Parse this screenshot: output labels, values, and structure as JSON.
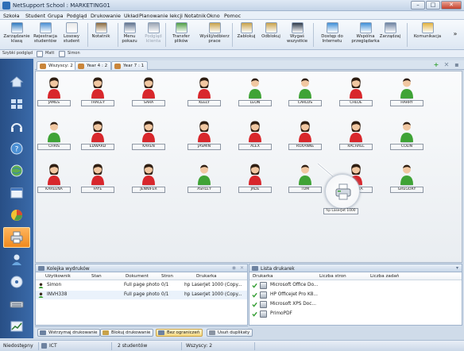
{
  "window": {
    "title": "NetSupport School : MARKETING01"
  },
  "menu": [
    "Szkoła",
    "Student",
    "Grupa",
    "Podgląd",
    "Drukowanie",
    "Układ",
    "Planowanie lekcji",
    "Notatnik",
    "Okno",
    "Pomoc"
  ],
  "ribbon": [
    {
      "label": "Zarządzanie\nklasą",
      "icon": "classroom-icon",
      "dim": false
    },
    {
      "label": "Rejestracja\nstudentów",
      "icon": "register-icon",
      "dim": false
    },
    {
      "label": "Losowy\nstudent",
      "icon": "dice-icon",
      "dim": false
    },
    {
      "label": "Notatnik",
      "icon": "notebook-icon",
      "dim": false
    },
    {
      "label": "Menu\npokazu",
      "icon": "show-icon",
      "dim": false
    },
    {
      "label": "Podgląd\nklienta",
      "icon": "view-icon",
      "dim": true
    },
    {
      "label": "Transfer\nplików",
      "icon": "transfer-icon",
      "dim": false
    },
    {
      "label": "Wyślij/odbierz\nprace",
      "icon": "send-icon",
      "dim": false
    },
    {
      "label": "Zablokuj",
      "icon": "lock-icon",
      "dim": false
    },
    {
      "label": "Odblokuj",
      "icon": "unlock-icon",
      "dim": false
    },
    {
      "label": "Wygaś\nwszystkie",
      "icon": "blank-icon",
      "dim": false
    },
    {
      "label": "Dostęp do\nInternetu",
      "icon": "internet-icon",
      "dim": false
    },
    {
      "label": "Wspólna\nprzeglądarka",
      "icon": "browser-icon",
      "dim": false
    },
    {
      "label": "Zarządzaj",
      "icon": "manage-icon",
      "dim": false
    },
    {
      "label": "Komunikacja",
      "icon": "chat-icon",
      "dim": false
    }
  ],
  "quickbar": {
    "label": "Szybki podgląd",
    "items": [
      "Matt",
      "Simon"
    ]
  },
  "tabs": [
    {
      "label": "Wszyscy: 2",
      "active": true
    },
    {
      "label": "Year 4 : 2",
      "active": false
    },
    {
      "label": "Year 7 : 1",
      "active": false
    }
  ],
  "students": [
    {
      "name": "JAMES",
      "gender": "female"
    },
    {
      "name": "TRACEY",
      "gender": "female"
    },
    {
      "name": "SARA",
      "gender": "female"
    },
    {
      "name": "KEELY",
      "gender": "female"
    },
    {
      "name": "LEON",
      "gender": "male"
    },
    {
      "name": "CARLOS",
      "gender": "male"
    },
    {
      "name": "CHLOE",
      "gender": "female"
    },
    {
      "name": "HARRY",
      "gender": "male"
    },
    {
      "name": "CHRIS",
      "gender": "male"
    },
    {
      "name": "EDWARD",
      "gender": "female"
    },
    {
      "name": "KAREN",
      "gender": "female"
    },
    {
      "name": "JASMIN",
      "gender": "female"
    },
    {
      "name": "ALEX",
      "gender": "female"
    },
    {
      "name": "ROXANNE",
      "gender": "female"
    },
    {
      "name": "RACHAEL",
      "gender": "female"
    },
    {
      "name": "COLIN",
      "gender": "male"
    },
    {
      "name": "KAREENA",
      "gender": "female"
    },
    {
      "name": "FAYE",
      "gender": "female"
    },
    {
      "name": "JENNIFER",
      "gender": "female"
    },
    {
      "name": "ASHLEY",
      "gender": "male"
    },
    {
      "name": "JADE",
      "gender": "female"
    },
    {
      "name": "TOM",
      "gender": "male"
    },
    {
      "name": "SOPHIA",
      "gender": "female"
    },
    {
      "name": "GREGORY",
      "gender": "male"
    }
  ],
  "printer_node": {
    "label": "hp LaserJet 1000"
  },
  "print_queue": {
    "title": "Kolejka wydruków",
    "columns": [
      "Użytkownik",
      "Stan",
      "Dokument",
      "Stron",
      "Drukarka"
    ],
    "rows": [
      {
        "user": "Simon",
        "status": "",
        "doc": "Full page photo",
        "pages": "0/1",
        "printer": "hp LaserJet 1000 (Copy..."
      },
      {
        "user": "INVH338",
        "status": "",
        "doc": "Full page photo",
        "pages": "0/1",
        "printer": "hp LaserJet 1000 (Copy..."
      }
    ]
  },
  "printer_list": {
    "title": "Lista drukarek",
    "columns": [
      "Drukarka",
      "Liczba stron",
      "Liczba zadań"
    ],
    "rows": [
      "Microsoft Office Do...",
      "HP Officejet Pro K8...",
      "Microsoft XPS Doc...",
      "PrimoPDF"
    ]
  },
  "job_buttons": [
    {
      "label": "Wstrzymaj drukowanie",
      "active": false
    },
    {
      "label": "Blokuj drukowanie",
      "active": false
    },
    {
      "label": "Bez ograniczeń",
      "active": true
    },
    {
      "label": "Usuń duplikaty",
      "active": false
    }
  ],
  "status": {
    "state": "Niedostępny",
    "network": "ICT",
    "count": "2 studentów",
    "group": "Wszyscy: 2"
  },
  "colors": {
    "female_shirt": "#d8272c",
    "male_shirt": "#3fa336",
    "accent": "#f08a1f",
    "sidebar": "#2e5b97"
  }
}
